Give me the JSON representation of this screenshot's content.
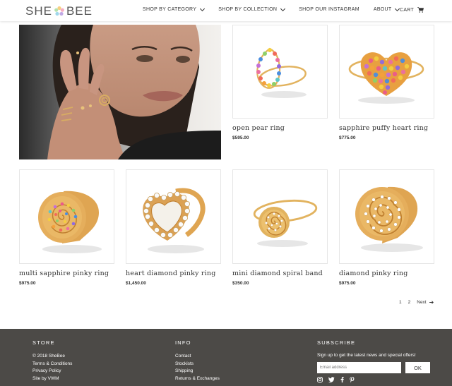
{
  "header": {
    "logo_left": "SHE",
    "logo_right": "BEE",
    "nav": [
      {
        "label": "SHOP BY CATEGORY"
      },
      {
        "label": "SHOP BY COLLECTION"
      },
      {
        "label": "SHOP OUR INSTAGRAM"
      },
      {
        "label": "ABOUT"
      }
    ],
    "cart_label": "CART"
  },
  "products": [
    {
      "name": "open pear ring",
      "price": "$595.00"
    },
    {
      "name": "sapphire puffy heart ring",
      "price": "$775.00"
    },
    {
      "name": "multi sapphire pinky ring",
      "price": "$975.00"
    },
    {
      "name": "heart diamond pinky ring",
      "price": "$1,450.00"
    },
    {
      "name": "mini diamond spiral band",
      "price": "$350.00"
    },
    {
      "name": "diamond pinky ring",
      "price": "$975.00"
    }
  ],
  "pagination": {
    "p1": "1",
    "p2": "2",
    "next": "Next"
  },
  "footer": {
    "store": {
      "title": "STORE",
      "links": [
        "© 2018 SheBee",
        "Terms & Conditions",
        "Privacy Policy",
        "Site by VWM"
      ]
    },
    "info": {
      "title": "INFO",
      "links": [
        "Contact",
        "Stockists",
        "Shipping",
        "Returns & Exchanges"
      ]
    },
    "subscribe": {
      "title": "SUBSCRIBE",
      "text": "Sign up to get the latest news and special offers!",
      "placeholder": "Email address",
      "button": "OK"
    }
  },
  "colors": {
    "footer_bg": "#4c4a47",
    "gold": "#e2b35f"
  }
}
